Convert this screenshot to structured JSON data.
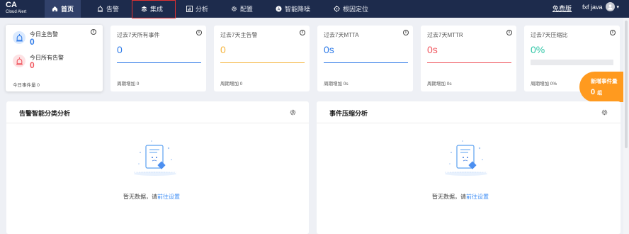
{
  "brand": {
    "title": "CA",
    "subtitle": "Cloud Alert"
  },
  "nav": {
    "items": [
      {
        "label": "首页",
        "icon": "home-icon"
      },
      {
        "label": "告警",
        "icon": "alarm-icon"
      },
      {
        "label": "集成",
        "icon": "layers-icon"
      },
      {
        "label": "分析",
        "icon": "chart-icon"
      },
      {
        "label": "配置",
        "icon": "gear-icon"
      },
      {
        "label": "智能降噪",
        "icon": "noise-icon"
      },
      {
        "label": "根因定位",
        "icon": "target-icon"
      }
    ],
    "free_label": "免费版",
    "user": "fxf java"
  },
  "today_card": {
    "main_label": "今日主告警",
    "main_value": "0",
    "all_label": "今日所有告警",
    "all_value": "0",
    "footer": "今日事件量 0"
  },
  "stats": [
    {
      "title": "过去7天所有事件",
      "value": "0",
      "footer": "周期增加 0",
      "color": "#2f7be8"
    },
    {
      "title": "过去7天主告警",
      "value": "0",
      "footer": "周期增加 0",
      "color": "#f5b53f"
    },
    {
      "title": "过去7天MTTA",
      "value": "0s",
      "footer": "周期增加 0s",
      "color": "#2f7be8"
    },
    {
      "title": "过去7天MTTR",
      "value": "0s",
      "footer": "周期增加 0s",
      "color": "#f0575f"
    },
    {
      "title": "过去7天压缩比",
      "value": "0%",
      "footer": "周期增加 0%",
      "color": "#33c7a8",
      "progress": 0
    }
  ],
  "new_events": {
    "label": "新增事件量",
    "value": "0",
    "unit": "组"
  },
  "panels": [
    {
      "title": "告警智能分类分析",
      "empty_text": "暂无数据，请",
      "link": "前往设置"
    },
    {
      "title": "事件压缩分析",
      "empty_text": "暂无数据，请",
      "link": "前往设置"
    }
  ]
}
